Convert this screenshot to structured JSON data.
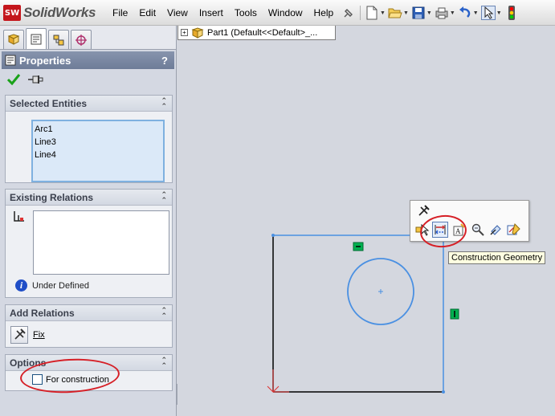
{
  "app": {
    "logo_badge": "SW",
    "logo_text": "SolidWorks"
  },
  "menu": [
    "File",
    "Edit",
    "View",
    "Insert",
    "Tools",
    "Window",
    "Help"
  ],
  "panel": {
    "title": "Properties",
    "help": "?",
    "selected_entities": {
      "title": "Selected Entities",
      "items": [
        "Arc1",
        "Line3",
        "Line4"
      ]
    },
    "existing_relations": {
      "title": "Existing Relations",
      "status": "Under Defined"
    },
    "add_relations": {
      "title": "Add Relations",
      "fix_label": "Fix"
    },
    "options": {
      "title": "Options",
      "for_construction": "For construction"
    }
  },
  "doc_tab": {
    "label": "Part1  (Default<<Default>_..."
  },
  "tooltip": "Construction Geometry",
  "colors": {
    "sketch_blue": "#4a90e2",
    "sketch_black": "#000000",
    "relation_green": "#00b050",
    "annotation_red": "#d61f26"
  }
}
